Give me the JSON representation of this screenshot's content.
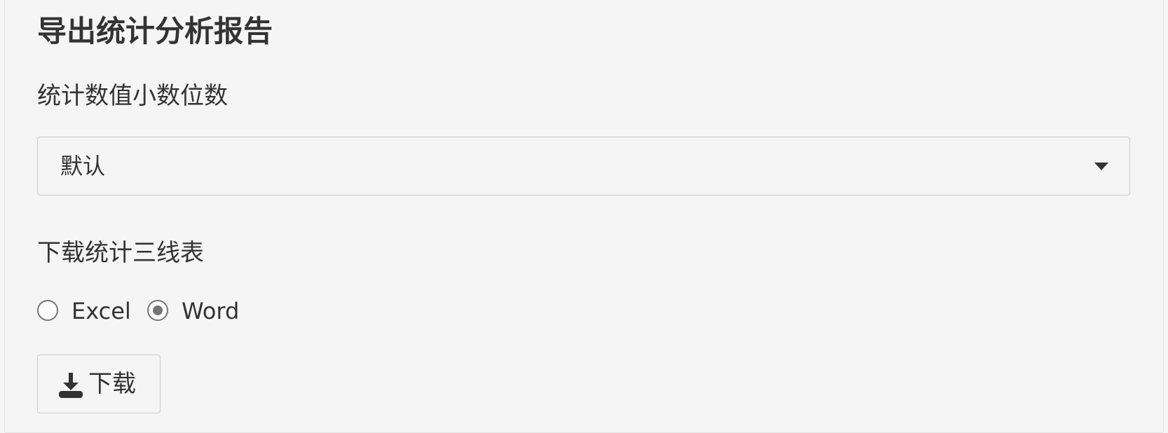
{
  "section": {
    "title": "导出统计分析报告"
  },
  "decimals": {
    "label": "统计数值小数位数",
    "selected_value": "默认"
  },
  "table_download": {
    "label": "下载统计三线表",
    "options": [
      {
        "label": "Excel",
        "selected": false
      },
      {
        "label": "Word",
        "selected": true
      }
    ]
  },
  "download_button": {
    "label": "下载",
    "icon": "download-icon"
  },
  "colors": {
    "background": "#f5f5f5",
    "text": "#333333",
    "border": "#cccccc",
    "radio": "#767676"
  }
}
